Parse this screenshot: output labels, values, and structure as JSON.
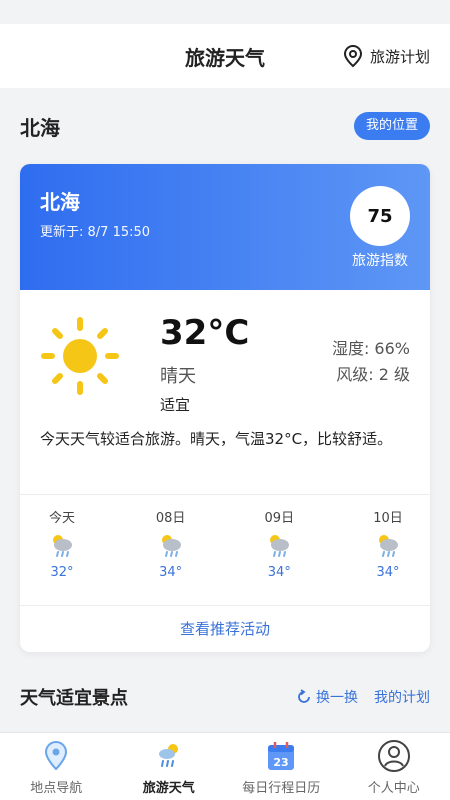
{
  "header": {
    "title": "旅游天气",
    "right_link": "旅游计划",
    "right_icon": "location-pin-icon"
  },
  "location": {
    "city": "北海",
    "button": "我的位置"
  },
  "card": {
    "city": "北海",
    "updated": "更新于: 8/7 15:50",
    "travel_index": "75",
    "travel_index_label": "旅游指数",
    "temperature": "32°C",
    "condition": "晴天",
    "suitability": "适宜",
    "humidity": "湿度: 66%",
    "wind": "风级: 2 级",
    "description": "今天天气较适合旅游。晴天，气温32°C，比较舒适。",
    "activity_link": "查看推荐活动",
    "accent_color": "#3b7cf0"
  },
  "forecast": [
    {
      "day": "今天",
      "temp": "32°",
      "icon": "cloud-rain-icon"
    },
    {
      "day": "08日",
      "temp": "34°",
      "icon": "cloud-rain-icon"
    },
    {
      "day": "09日",
      "temp": "34°",
      "icon": "cloud-rain-icon"
    },
    {
      "day": "10日",
      "temp": "34°",
      "icon": "cloud-rain-icon"
    }
  ],
  "spots": {
    "title": "天气适宜景点",
    "refresh": "换一换",
    "my_plan": "我的计划"
  },
  "tabs": [
    {
      "label": "地点导航",
      "icon": "map-pin-icon"
    },
    {
      "label": "旅游天气",
      "icon": "weather-icon"
    },
    {
      "label": "每日行程日历",
      "icon": "calendar-icon",
      "badge": "23"
    },
    {
      "label": "个人中心",
      "icon": "user-icon"
    }
  ]
}
